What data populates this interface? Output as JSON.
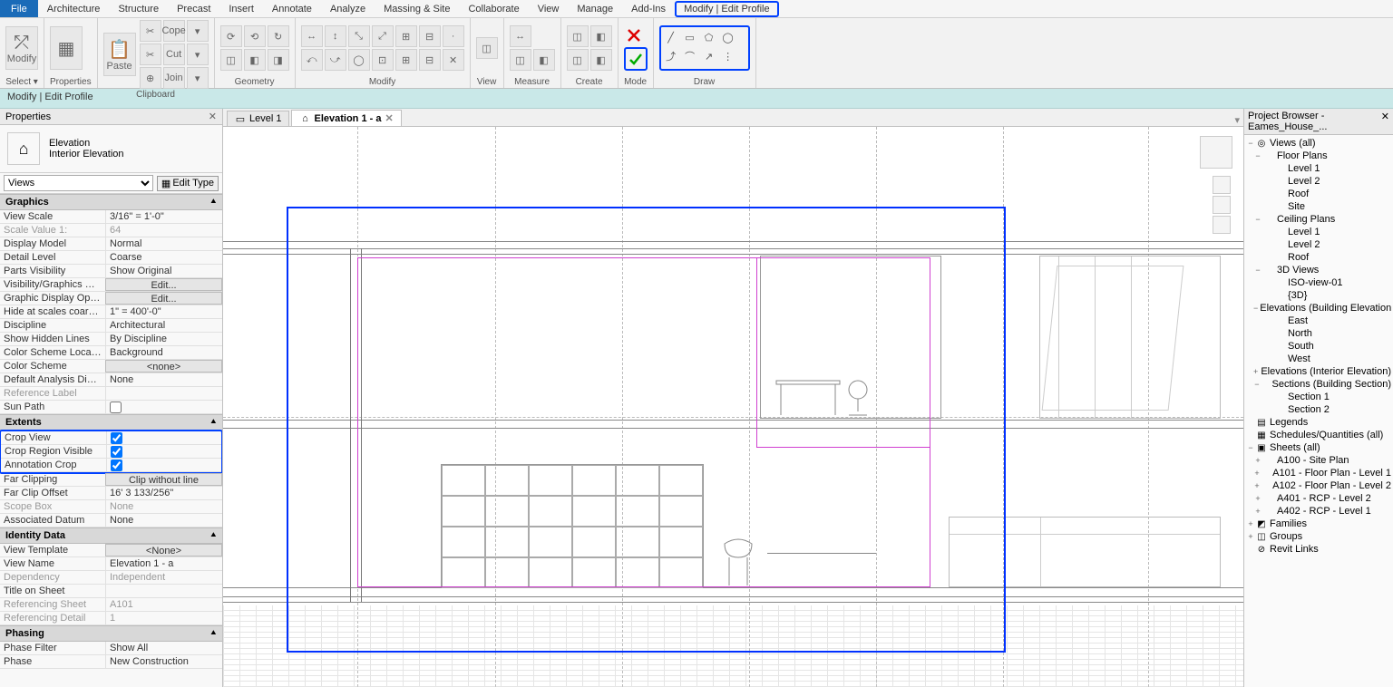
{
  "menubar": {
    "file": "File",
    "tabs": [
      "Architecture",
      "Structure",
      "Precast",
      "Insert",
      "Annotate",
      "Analyze",
      "Massing & Site",
      "Collaborate",
      "View",
      "Manage",
      "Add-Ins",
      "Modify | Edit Profile"
    ]
  },
  "ribbon": {
    "groups": [
      {
        "label": "Select ▾",
        "big": [
          {
            "t": "Modify",
            "g": "⤱"
          }
        ]
      },
      {
        "label": "Properties",
        "big": [
          {
            "t": "",
            "g": "▦"
          }
        ]
      },
      {
        "label": "Clipboard",
        "big": [
          {
            "t": "Paste",
            "g": "📋"
          }
        ],
        "rows": [
          [
            "✂",
            "Cope",
            "▾"
          ],
          [
            "✂",
            "Cut",
            "▾"
          ],
          [
            "⊕",
            "Join",
            "▾"
          ]
        ]
      },
      {
        "label": "Geometry",
        "rows": [
          [
            "⟳",
            "⟲",
            "↻"
          ],
          [
            "◫",
            "◧",
            "◨"
          ]
        ]
      },
      {
        "label": "Modify",
        "rows": [
          [
            "↔",
            "↕",
            "⤡",
            "⤢",
            "⊞",
            "⊟",
            "·"
          ],
          [
            "⤺",
            "⤻",
            "◯",
            "⊡",
            "⊞",
            "⊟",
            "✕"
          ]
        ]
      },
      {
        "label": "View",
        "rows": [
          [
            "◫"
          ]
        ]
      },
      {
        "label": "Measure",
        "rows": [
          [
            "↔"
          ],
          [
            "◫",
            "◧"
          ]
        ]
      },
      {
        "label": "Create",
        "rows": [
          [
            "◫",
            "◧"
          ],
          [
            "◫",
            "◧"
          ]
        ]
      },
      {
        "label": "Mode",
        "mode": true
      },
      {
        "label": "Draw",
        "draw": true
      }
    ]
  },
  "context_bar": "Modify | Edit Profile",
  "properties": {
    "title": "Properties",
    "type_name": "Elevation",
    "type_sub": "Interior Elevation",
    "selector": "Views",
    "edit_type": "Edit Type",
    "cats": [
      {
        "name": "Graphics",
        "rows": [
          {
            "k": "View Scale",
            "v": "3/16\" = 1'-0\""
          },
          {
            "k": "Scale Value   1:",
            "v": "64",
            "dim": true
          },
          {
            "k": "Display Model",
            "v": "Normal"
          },
          {
            "k": "Detail Level",
            "v": "Coarse"
          },
          {
            "k": "Parts Visibility",
            "v": "Show Original"
          },
          {
            "k": "Visibility/Graphics Overr...",
            "v": "Edit...",
            "btn": true
          },
          {
            "k": "Graphic Display Options",
            "v": "Edit...",
            "btn": true
          },
          {
            "k": "Hide at scales coarser th...",
            "v": "1\" = 400'-0\""
          },
          {
            "k": "Discipline",
            "v": "Architectural"
          },
          {
            "k": "Show Hidden Lines",
            "v": "By Discipline"
          },
          {
            "k": "Color Scheme Location",
            "v": "Background"
          },
          {
            "k": "Color Scheme",
            "v": "<none>",
            "btn": true
          },
          {
            "k": "Default Analysis Display ...",
            "v": "None"
          },
          {
            "k": "Reference Label",
            "v": "",
            "dim": true
          },
          {
            "k": "Sun Path",
            "v": "",
            "check": false
          }
        ]
      },
      {
        "name": "Extents",
        "highlight": true,
        "rows": [
          {
            "k": "Crop View",
            "v": "",
            "check": true
          },
          {
            "k": "Crop Region Visible",
            "v": "",
            "check": true
          },
          {
            "k": "Annotation Crop",
            "v": "",
            "check": true
          }
        ]
      },
      {
        "name": "",
        "rows": [
          {
            "k": "Far Clipping",
            "v": "Clip without line",
            "btn": true
          },
          {
            "k": "Far Clip Offset",
            "v": "16'  3 133/256\""
          },
          {
            "k": "Scope Box",
            "v": "None",
            "dim": true
          },
          {
            "k": "Associated Datum",
            "v": "None"
          }
        ]
      },
      {
        "name": "Identity Data",
        "rows": [
          {
            "k": "View Template",
            "v": "<None>",
            "btn": true
          },
          {
            "k": "View Name",
            "v": "Elevation 1 - a"
          },
          {
            "k": "Dependency",
            "v": "Independent",
            "dim": true
          },
          {
            "k": "Title on Sheet",
            "v": ""
          },
          {
            "k": "Referencing Sheet",
            "v": "A101",
            "dim": true
          },
          {
            "k": "Referencing Detail",
            "v": "1",
            "dim": true
          }
        ]
      },
      {
        "name": "Phasing",
        "rows": [
          {
            "k": "Phase Filter",
            "v": "Show All"
          },
          {
            "k": "Phase",
            "v": "New Construction"
          }
        ]
      }
    ]
  },
  "doc_tabs": [
    {
      "label": "Level 1",
      "active": false,
      "icon": "▭"
    },
    {
      "label": "Elevation 1 - a",
      "active": true,
      "icon": "⌂",
      "close": true
    }
  ],
  "browser": {
    "title": "Project Browser - Eames_House_...",
    "tree": [
      {
        "ind": 0,
        "exp": "−",
        "icon": "◎",
        "lbl": "Views (all)"
      },
      {
        "ind": 1,
        "exp": "−",
        "icon": "",
        "lbl": "Floor Plans"
      },
      {
        "ind": 2,
        "exp": "",
        "icon": "",
        "lbl": "Level 1"
      },
      {
        "ind": 2,
        "exp": "",
        "icon": "",
        "lbl": "Level 2"
      },
      {
        "ind": 2,
        "exp": "",
        "icon": "",
        "lbl": "Roof"
      },
      {
        "ind": 2,
        "exp": "",
        "icon": "",
        "lbl": "Site"
      },
      {
        "ind": 1,
        "exp": "−",
        "icon": "",
        "lbl": "Ceiling Plans"
      },
      {
        "ind": 2,
        "exp": "",
        "icon": "",
        "lbl": "Level 1"
      },
      {
        "ind": 2,
        "exp": "",
        "icon": "",
        "lbl": "Level 2"
      },
      {
        "ind": 2,
        "exp": "",
        "icon": "",
        "lbl": "Roof"
      },
      {
        "ind": 1,
        "exp": "−",
        "icon": "",
        "lbl": "3D Views"
      },
      {
        "ind": 2,
        "exp": "",
        "icon": "",
        "lbl": "ISO-view-01"
      },
      {
        "ind": 2,
        "exp": "",
        "icon": "",
        "lbl": "{3D}"
      },
      {
        "ind": 1,
        "exp": "−",
        "icon": "",
        "lbl": "Elevations (Building Elevation"
      },
      {
        "ind": 2,
        "exp": "",
        "icon": "",
        "lbl": "East"
      },
      {
        "ind": 2,
        "exp": "",
        "icon": "",
        "lbl": "North"
      },
      {
        "ind": 2,
        "exp": "",
        "icon": "",
        "lbl": "South"
      },
      {
        "ind": 2,
        "exp": "",
        "icon": "",
        "lbl": "West"
      },
      {
        "ind": 1,
        "exp": "+",
        "icon": "",
        "lbl": "Elevations (Interior Elevation)"
      },
      {
        "ind": 1,
        "exp": "−",
        "icon": "",
        "lbl": "Sections (Building Section)"
      },
      {
        "ind": 2,
        "exp": "",
        "icon": "",
        "lbl": "Section 1"
      },
      {
        "ind": 2,
        "exp": "",
        "icon": "",
        "lbl": "Section 2"
      },
      {
        "ind": 0,
        "exp": "",
        "icon": "▤",
        "lbl": "Legends"
      },
      {
        "ind": 0,
        "exp": "",
        "icon": "▦",
        "lbl": "Schedules/Quantities (all)"
      },
      {
        "ind": 0,
        "exp": "−",
        "icon": "▣",
        "lbl": "Sheets (all)"
      },
      {
        "ind": 1,
        "exp": "+",
        "icon": "",
        "lbl": "A100 - Site Plan"
      },
      {
        "ind": 1,
        "exp": "+",
        "icon": "",
        "lbl": "A101 - Floor Plan - Level 1"
      },
      {
        "ind": 1,
        "exp": "+",
        "icon": "",
        "lbl": "A102 - Floor Plan - Level 2"
      },
      {
        "ind": 1,
        "exp": "+",
        "icon": "",
        "lbl": "A401 - RCP - Level 2"
      },
      {
        "ind": 1,
        "exp": "+",
        "icon": "",
        "lbl": "A402 - RCP - Level 1"
      },
      {
        "ind": 0,
        "exp": "+",
        "icon": "◩",
        "lbl": "Families"
      },
      {
        "ind": 0,
        "exp": "+",
        "icon": "◫",
        "lbl": "Groups"
      },
      {
        "ind": 0,
        "exp": "",
        "icon": "⊘",
        "lbl": "Revit Links"
      }
    ]
  }
}
